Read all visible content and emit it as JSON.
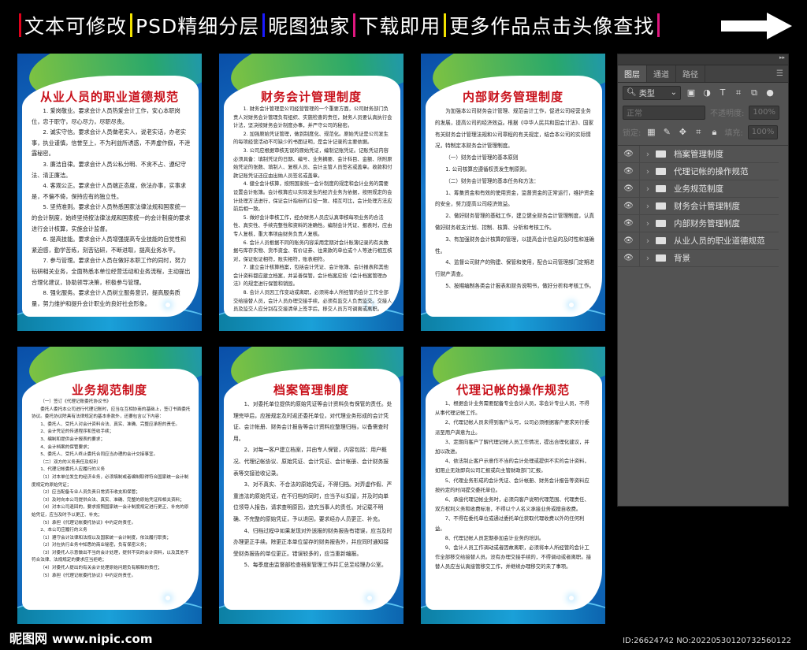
{
  "banner": {
    "items": [
      {
        "text": "文本可修改",
        "color": "#e0001b"
      },
      {
        "text": "PSD精细分层",
        "color": "#f2e200"
      },
      {
        "text": "昵图独家",
        "color": "#1a1aff"
      },
      {
        "text": "下载即用",
        "color": "#e0177f"
      },
      {
        "text": "更多作品点击头像查找",
        "color": "#f2e200"
      }
    ],
    "end_color": "#e0177f"
  },
  "posters": [
    {
      "title": "从业人员的职业道德规范",
      "paras": [
        "1. 爱岗敬业。要求会计人员热爱会计工作，安心本职岗位，忠于职守，尽心尽力，尽职尽责。",
        "2. 诚实守信。要求会计人员做老实人，说老实话，办老实事，执业谨慎，信誉至上，不为利益所诱惑，不弄虚作假，不泄露秘密。",
        "3. 廉洁自律。要求会计人员公私分明、不贪不占、遵纪守法、清正廉洁。",
        "4. 客观公正。要求会计人员端正态度，依法办事，实事求是，不偏不倚，保持应有的独立性。",
        "5. 坚持准则。要求会计人员熟悉国家法律法规和国家统一的会计制度，始终坚持按法律法规和国家统一的会计制度的要求进行会计核算，实施会计监督。",
        "6. 提高技能。要求会计人员增强提高专业技能的自觉性和紧迫感，勤学苦练，刻苦钻研，不断进取，提高业务水平。",
        "7. 参与管理。要求会计人员在做好本职工作的同时，努力钻研相关业务，全面熟悉本单位经营活动和业务流程，主动提出合理化建议，协助领导决策，积极参与管理。",
        "8. 强化服务。要求会计人员树立服务意识，提高服务质量，努力维护和提升会计职业的良好社会形象。"
      ]
    },
    {
      "title": "财务会计管理制度",
      "paras": [
        "1. 财务会计管理是公司经营管理的一个重要方面，公司财务部门负责人对财务会计管理负有组织、实施检查的责任，财务人员要认真执行会计法，坚决按财务会计制度办事，并严守公司的秘密。",
        "2. 加强原始凭证管理，做到制度化、规范化。原始凭证是公司发生的每项经营活动不可缺少的书面证明，是会计记录的主要依据。",
        "3. 公司应根据审核无误的原始凭证，编制记账凭证。记账凭证内容必须具备：填制凭证的日期、编号、业务摘要、会计科目、金额、所附原始凭证的张数、填制人、复核人员、会计主管人员签名或盖章。收款和付款记账凭证还应由出纳人员签名或盖章。",
        "4. 健全会计核算，按照国家统一会计制度的规定和会计业务的需要设置会计账簿。会计核算应以实际发生的经济业务为依据，按照规定的会计处理方法进行，保证会计指标的口径一致、相互可比，会计处理方法应前后相一致。",
        "5. 做好会计审核工作，经办财务人员应认真审核每项业务的合法性、真实性、手续完整性和资料的准确性。编制会计凭证、报表时，应由专人复核，重大事项由财务负责人复核。",
        "6. 会计人员根据不同的账务内容采用定期对会计账簿记录的有关数据与库存实物、货币资金、有价证券、往来款的单位或个人等进行相互核对，保证账证相符，账实相符，账表相符。",
        "7. 建立会计核算档案，包括会计凭证、会计账簿、会计报表和其他会计资料都应建立档案，并妥善保管。会计档案应按《会计档案管理办法》的规定进行保管和销毁。",
        "8. 会计人员因工作变动或离职，必须将本人所经管的会计工作全部交给接替人员，会计人员办理交接手续，必须有监交人负责监交。交接人员及监交人应分别在交接清单上签字后，移交人员方可调离或离职。"
      ]
    },
    {
      "title": "内部财务管理制度",
      "paras": [
        "为加强本公司财务会计管理、规范会计工作，促进公司经营业务的发展，提高公司的经济效益。根据《中华人民共和国会计法》、国家有关财务会计管理法规和公司章程的有关规定，结合本公司的实际情况，特制定本财务会计管理制度。",
        "（一）财务会计管理的基本原则",
        "1. 公司核算应遵循权责发生制原则。",
        "（二）财务会计管理的基本任务和方法：",
        "1、筹集资金和有效的使用资金，监督资金的正常运行，维护资金的安全，努力提高公司经济效益。",
        "2、做好财务管理的基础工作，建立健全财务会计管理制度，认真做好财务收支计划、控制、核算、分析和考核工作。",
        "3、有加强财务会计核算的管理，以提高会计信息的及时性和准确性。",
        "4、监督公司财产的购建、保管和使用，配合公司管理部门定期进行财产清查。",
        "5、按期编制各类会计报表和财务说明书，做好分析和考核工作。"
      ]
    },
    {
      "title": "业务规范制度",
      "paras": [
        "（一）签订《代理记账委托协议书》",
        "委托人委托本公司进行代理记账时，应当在互相协商的基础上，签订书面委托协议。委托协议除具有法律规定的基本条款外，还要包含以下内容：",
        "1、委托人、受托人对会计资料合法、真实、准确、完整应承担的责任。",
        "2、会计凭证的传递程序和签收手续；",
        "3、编制和提供会计报表的要求；",
        "4、会计档案的保管要求；",
        "5、委托人、受托人终止委托合同应当办理的会计交接事宜。",
        "（二）双方的义务责任及权利",
        "1、代理记帐委托人应履行的义务",
        "（1）对本单位发生的经济业务，必须填制或者编制取得符合国家统一会计制度规定的原始凭证；",
        "（2）应当配备专业人员负责日常货币收支和保管；",
        "（3）及时向本公司提供合法、真实、准确、完整的原始凭证和相关资料；",
        "（4）对本公司退回的，要求按照国家统一会计制度规定进行更正、补充的原始凭证，应当及时予以更正、补充；",
        "（5）承担《代理记帐委托协议》中约定的责任。",
        "2、本公司应履行的义务",
        "（1）遵守会计法律和法规以及国家统一会计制度，依法履行职责；",
        "（2）对在执行业务中知悉的商业秘密，负有保密义务；",
        "（3）对委托人示意做出不当的会计处理，提供不实的会计资料，以及其他不符合法律、法规规定的要求应当拒绝；",
        "（4）对委托人提出的有关会计处理原始问题负有解释的责任；",
        "（5）承担《代理记帐委托协议》中约定的责任。"
      ]
    },
    {
      "title": "档案管理制度",
      "paras": [
        "1、对委托单位提供的原始凭证等会计资料负有保管的责任。处理完毕后，应按规定及时返还委托单位，对代理业务形成的会计凭证、会计帐册、财务会计报告等会计资料应整理归档，以备需查时用。",
        "2、对每一客户建立档案，并由专人保管，内容包括：用户概况、代理记帐协议、原始凭证、会计凭证、会计帐册、会计财务报表等交接验收记录。",
        "3、对不真实、不合法的原始凭证，不得归档。对弄虚作假、严重违法的原始凭证，在不归档的同时，应当予以扣留，并及时向单位领导人报告，请求查明原因，追究当事人的责任。对记载不明确、不完整的原始凭证，予以退回，要求经办人员更正、补充。",
        "4、归档过程中如果发现对外送报的财务报告有错误，应当及时办理更正手续。除更正本单位留存的财务报告外，并应同时通知接受财务报告的单位更正。错误较多的，应当重新编报。",
        "5、每季度由监督部检查档案管理工作并汇总至经理办公室。"
      ]
    },
    {
      "title": "代理记帐的操作规范",
      "paras": [
        "1、根据会计业务需要配备专业会计人员，非会计专业人员，不得从事代理记帐工作。",
        "2、代理记帐人员未得到客户认可，公司必须根据客户要求另行委派至用户满意为止。",
        "3、定期向客户了解代理记帐人员工作情况，提出合理化建议，并加以改进。",
        "4、依法制止客户示意作不当的会计处理或提供不实的会计资料，如阻止无效即向公司汇报或向主管财政部门汇报。",
        "5、代理业务形成的会计凭证、会计帐册、财务会计报告等资料应按约定的时间提交委托单位。",
        "6、承接代理记帐业务时，必须向客户说明代理范围、代理责任、双方权利义务和收费标准，不得以个人名义承接业务或擅自收费。",
        "7、不得在委托单位或通过委托单位获取代理收费以外的任何利益。",
        "8、代理记帐人员定期参加会计业务的培训。",
        "9、会计人员工作调动或者因故离职，必须将本人所经管的会计工作全部移交给接替人员。没有办理交接手续的，不得调动或者离职。接替人员应当认真接管移交工作，并继续办理移交的未了事项。"
      ]
    }
  ],
  "ps": {
    "tabs": [
      "图层",
      "通道",
      "路径"
    ],
    "filter_label": "类型",
    "blend_mode": "正常",
    "opacity_label": "不透明度:",
    "opacity": "100%",
    "lock_label": "锁定:",
    "fill_label": "填充:",
    "fill": "100%",
    "layers": [
      "档案管理制度",
      "代理记帐的操作规范",
      "业务规范制度",
      "财务会计管理制度",
      "内部财务管理制度",
      "从业人员的职业道德规范",
      "背景"
    ]
  },
  "footer": {
    "logo": "昵图网",
    "url": "www.nipic.com",
    "id": "ID:26624742 NO:20220530120732560122"
  }
}
